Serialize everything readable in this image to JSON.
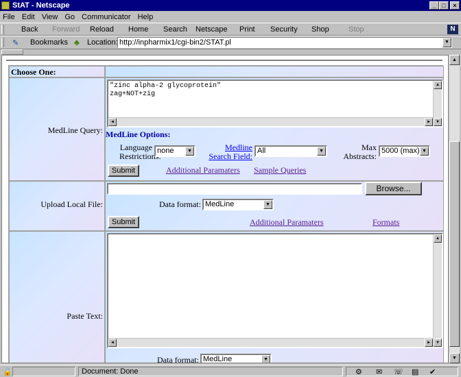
{
  "window": {
    "title": "StAT - Netscape"
  },
  "menu": [
    "File",
    "Edit",
    "View",
    "Go",
    "Communicator",
    "Help"
  ],
  "toolbar": {
    "back": "Back",
    "forward": "Forward",
    "reload": "Reload",
    "home": "Home",
    "search": "Search",
    "netscape": "Netscape",
    "print": "Print",
    "security": "Security",
    "shop": "Shop",
    "stop": "Stop"
  },
  "location": {
    "bookmarks": "Bookmarks",
    "label": "Location:",
    "url": "http://inpharmix1/cgi-bin2/STAT.pl"
  },
  "form": {
    "header": "Choose One:",
    "medline": {
      "label": "MedLine Query:",
      "query_line1": "\"zinc alpha-2 glycoprotein\"",
      "query_line2": "zag+NOT+zig",
      "options_title": "MedLine Options:",
      "lang_label_1": "Language",
      "lang_label_2": "Restrictions:",
      "lang_value": "none",
      "field_label_1": "Medline",
      "field_label_2": "Search Field:",
      "field_value": "All",
      "max_label_1": "Max",
      "max_label_2": "Abstracts:",
      "max_value": "5000 (max)",
      "submit": "Submit",
      "additional": "Additional Paramaters",
      "samples": "Sample Queries"
    },
    "upload": {
      "label": "Upload Local File:",
      "browse": "Browse...",
      "format_label": "Data format:",
      "format_value": "MedLine",
      "submit": "Submit",
      "additional": "Additional Paramaters",
      "formats": "Formats"
    },
    "paste": {
      "label": "Paste Text:",
      "format_label": "Data format:",
      "format_value": "MedLine"
    }
  },
  "status": {
    "text": "Document: Done"
  }
}
